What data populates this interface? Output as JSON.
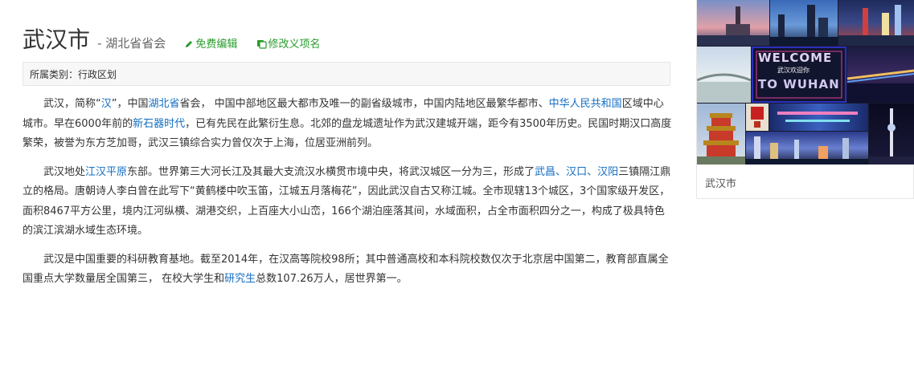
{
  "header": {
    "title": "武汉市",
    "subtitle": "- 湖北省省会",
    "edit_label": "免费编辑",
    "rename_label": "修改义项名"
  },
  "category": {
    "text": "所属类别：行政区划"
  },
  "paragraphs": {
    "p1": {
      "t1": "武汉，简称“",
      "l1": "汉",
      "t2": "”，中国",
      "l2": "湖北省",
      "t3": "省会， 中国中部地区最大都市及唯一的副省级城市，中国内陆地区最繁华都市、",
      "l3": "中华人民共和国",
      "t4": "区域中心城市。早在6000年前的",
      "l4": "新石器时代",
      "t5": "，已有先民在此繁衍生息。北郊的盘龙城遗址作为武汉建城开端，距今有3500年历史。民国时期汉口高度繁荣，被誉为东方芝加哥，武汉三镇综合实力曾仅次于上海，位居亚洲前列。"
    },
    "p2": {
      "t1": "武汉地处",
      "l1": "江汉平原",
      "t2": "东部。世界第三大河长江及其最大支流汉水横贯市境中央，将武汉城区一分为三，形成了",
      "l2": "武昌",
      "s1": "、",
      "l3": "汉口",
      "s2": "、",
      "l4": "汉阳",
      "t3": "三镇隔江鼎立的格局。唐朝诗人李白曾在此写下“黄鹤楼中吹玉笛，江城五月落梅花”，因此武汉自古又称江城。全市现辖13个城区，3个国家级开发区，面积8467平方公里，境内江河纵横、湖港交织，上百座大小山峦，166个湖泊座落其间，水域面积，占全市面积四分之一，构成了极具特色的滨江滨湖水域生态环境。"
    },
    "p3": {
      "t1": "武汉是中国重要的科研教育基地。截至2014年，在汉高等院校98所；其中普通高校和本科院校数仅次于北京居中国第二，教育部直属全国重点大学数量居全国第三， 在校大学生和",
      "l1": "研究生",
      "t2": "总数107.26万人，居世界第一。"
    }
  },
  "infobox": {
    "caption": "武汉市",
    "welcome_top": "WELCOME",
    "welcome_bottom": "TO WUHAN",
    "welcome_cn": "武汉欢迎你"
  },
  "colors": {
    "link": "#136ec2",
    "action": "#279c2a",
    "text": "#333333"
  }
}
